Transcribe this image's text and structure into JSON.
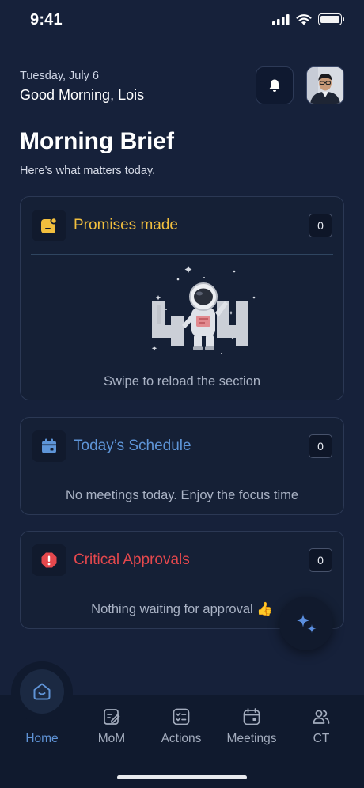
{
  "status_bar": {
    "time": "9:41"
  },
  "header": {
    "date": "Tuesday, July 6",
    "greeting": "Good Morning, Lois"
  },
  "page": {
    "title": "Morning Brief",
    "subtitle": "Here’s what matters today."
  },
  "cards": {
    "promises": {
      "title": "Promises made",
      "count": "0",
      "message": "Swipe to reload the section",
      "illustration_text": "404",
      "accent": "#f2bf3e"
    },
    "schedule": {
      "title": "Today’s Schedule",
      "count": "0",
      "message": "No meetings today. Enjoy the focus time",
      "accent": "#5e95d8"
    },
    "approvals": {
      "title": "Critical Approvals",
      "count": "0",
      "message": "Nothing waiting for approval 👍",
      "accent": "#e5484d"
    }
  },
  "fab": {
    "icon": "sparkle-icon"
  },
  "nav": {
    "items": [
      {
        "label": "Home",
        "icon": "home-icon",
        "active": true
      },
      {
        "label": "MoM",
        "icon": "notes-edit-icon"
      },
      {
        "label": "Actions",
        "icon": "checklist-icon"
      },
      {
        "label": "Meetings",
        "icon": "calendar-icon"
      },
      {
        "label": "CT",
        "icon": "users-icon"
      }
    ]
  }
}
